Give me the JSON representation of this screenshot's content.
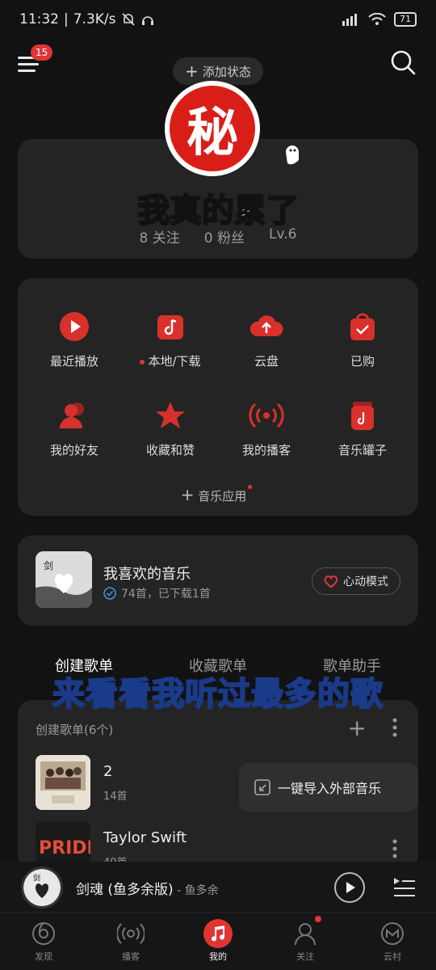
{
  "status_bar": {
    "time": "11:32",
    "speed": "7.3K/s",
    "battery": "71"
  },
  "header": {
    "menu_badge": "15",
    "add_status_label": "添加状态"
  },
  "profile": {
    "stamp_text": "秘",
    "nickname": "我真的累了",
    "follow": "8 关注",
    "fans": "0 粉丝",
    "level": "Lv.6"
  },
  "features": {
    "items": [
      {
        "label": "最近播放",
        "icon": "play-circle-icon"
      },
      {
        "label": "本地/下载",
        "icon": "music-box-icon"
      },
      {
        "label": "云盘",
        "icon": "cloud-upload-icon"
      },
      {
        "label": "已购",
        "icon": "shopping-bag-icon"
      },
      {
        "label": "我的好友",
        "icon": "friends-icon"
      },
      {
        "label": "收藏和赞",
        "icon": "star-icon"
      },
      {
        "label": "我的播客",
        "icon": "broadcast-icon"
      },
      {
        "label": "音乐罐子",
        "icon": "music-jar-icon"
      }
    ],
    "music_apps_label": "音乐应用"
  },
  "liked": {
    "title": "我喜欢的音乐",
    "subtitle": "74首，已下载1首",
    "heart_mode_label": "心动模式"
  },
  "playlist_tabs": [
    "创建歌单",
    "收藏歌单",
    "歌单助手"
  ],
  "overlay_caption": "来看看我听过最多的歌",
  "created": {
    "header": "创建歌单(6个)",
    "playlists": [
      {
        "name": "2",
        "count": "14首"
      },
      {
        "name": "Taylor Swift",
        "count": "40首"
      }
    ],
    "import_label": "一键导入外部音乐"
  },
  "mini_player": {
    "title": "剑魂 (鱼多余版)",
    "artist": " - 鱼多余"
  },
  "bottom_nav": [
    "发现",
    "播客",
    "我的",
    "关注",
    "云村"
  ],
  "colors": {
    "accent": "#e03535",
    "background": "#121212",
    "card": "#242424"
  }
}
